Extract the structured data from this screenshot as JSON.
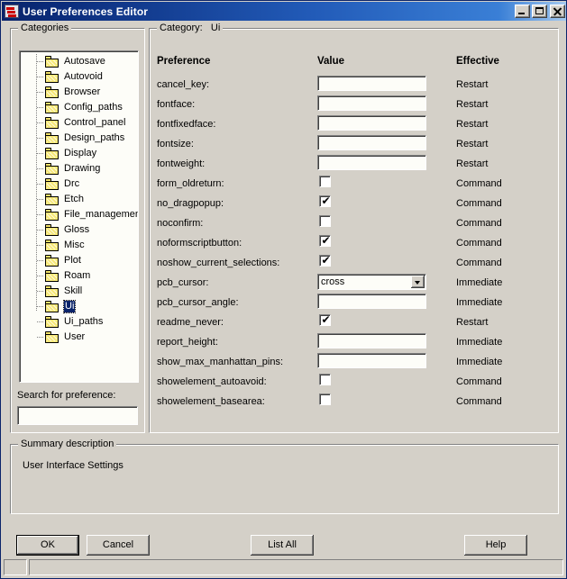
{
  "window": {
    "title": "User Preferences Editor",
    "icon": "app-stack-icon",
    "buttons": {
      "minimize": "minimize-icon",
      "maximize": "maximize-icon",
      "close": "close-icon"
    }
  },
  "categories_group": {
    "title": "Categories",
    "items": [
      {
        "label": "Autosave",
        "selected": false
      },
      {
        "label": "Autovoid",
        "selected": false
      },
      {
        "label": "Browser",
        "selected": false
      },
      {
        "label": "Config_paths",
        "selected": false
      },
      {
        "label": "Control_panel",
        "selected": false
      },
      {
        "label": "Design_paths",
        "selected": false
      },
      {
        "label": "Display",
        "selected": false
      },
      {
        "label": "Drawing",
        "selected": false
      },
      {
        "label": "Drc",
        "selected": false
      },
      {
        "label": "Etch",
        "selected": false
      },
      {
        "label": "File_management",
        "selected": false
      },
      {
        "label": "Gloss",
        "selected": false
      },
      {
        "label": "Misc",
        "selected": false
      },
      {
        "label": "Plot",
        "selected": false
      },
      {
        "label": "Roam",
        "selected": false
      },
      {
        "label": "Skill",
        "selected": false
      },
      {
        "label": "Ui",
        "selected": true
      },
      {
        "label": "Ui_paths",
        "selected": false
      },
      {
        "label": "User",
        "selected": false
      }
    ],
    "search_label": "Search for preference:",
    "search_value": "",
    "search_placeholder": ""
  },
  "category_group": {
    "title_prefix": "Category:",
    "title_value": "Ui",
    "headers": {
      "preference": "Preference",
      "value": "Value",
      "effective": "Effective"
    },
    "rows": [
      {
        "name": "cancel_key:",
        "type": "text",
        "value": "",
        "effective": "Restart"
      },
      {
        "name": "fontface:",
        "type": "text",
        "value": "",
        "effective": "Restart"
      },
      {
        "name": "fontfixedface:",
        "type": "text",
        "value": "",
        "effective": "Restart"
      },
      {
        "name": "fontsize:",
        "type": "text",
        "value": "",
        "effective": "Restart"
      },
      {
        "name": "fontweight:",
        "type": "text",
        "value": "",
        "effective": "Restart"
      },
      {
        "name": "form_oldreturn:",
        "type": "checkbox",
        "checked": false,
        "effective": "Command"
      },
      {
        "name": "no_dragpopup:",
        "type": "checkbox",
        "checked": true,
        "effective": "Command"
      },
      {
        "name": "noconfirm:",
        "type": "checkbox",
        "checked": false,
        "effective": "Command"
      },
      {
        "name": "noformscriptbutton:",
        "type": "checkbox",
        "checked": true,
        "effective": "Command"
      },
      {
        "name": "noshow_current_selections:",
        "type": "checkbox",
        "checked": true,
        "effective": "Command"
      },
      {
        "name": "pcb_cursor:",
        "type": "combo",
        "value": "cross",
        "effective": "Immediate"
      },
      {
        "name": "pcb_cursor_angle:",
        "type": "text",
        "value": "",
        "effective": "Immediate"
      },
      {
        "name": "readme_never:",
        "type": "checkbox",
        "checked": true,
        "effective": "Restart"
      },
      {
        "name": "report_height:",
        "type": "text",
        "value": "",
        "effective": "Immediate"
      },
      {
        "name": "show_max_manhattan_pins:",
        "type": "text",
        "value": "",
        "effective": "Immediate"
      },
      {
        "name": "showelement_autoavoid:",
        "type": "checkbox",
        "checked": false,
        "effective": "Command"
      },
      {
        "name": "showelement_basearea:",
        "type": "checkbox",
        "checked": false,
        "effective": "Command"
      }
    ]
  },
  "summary_group": {
    "title": "Summary description",
    "text": "User Interface Settings"
  },
  "footer": {
    "ok": "OK",
    "cancel": "Cancel",
    "list_all": "List All",
    "help": "Help"
  },
  "statusbar": {
    "left_pane": "",
    "main_pane": ""
  },
  "colors": {
    "face": "#d4d0c8",
    "title_start": "#0a246a",
    "title_end": "#a6caf0",
    "selection": "#0a246a",
    "folder": "#f7e878",
    "field": "#fdfdf8"
  }
}
